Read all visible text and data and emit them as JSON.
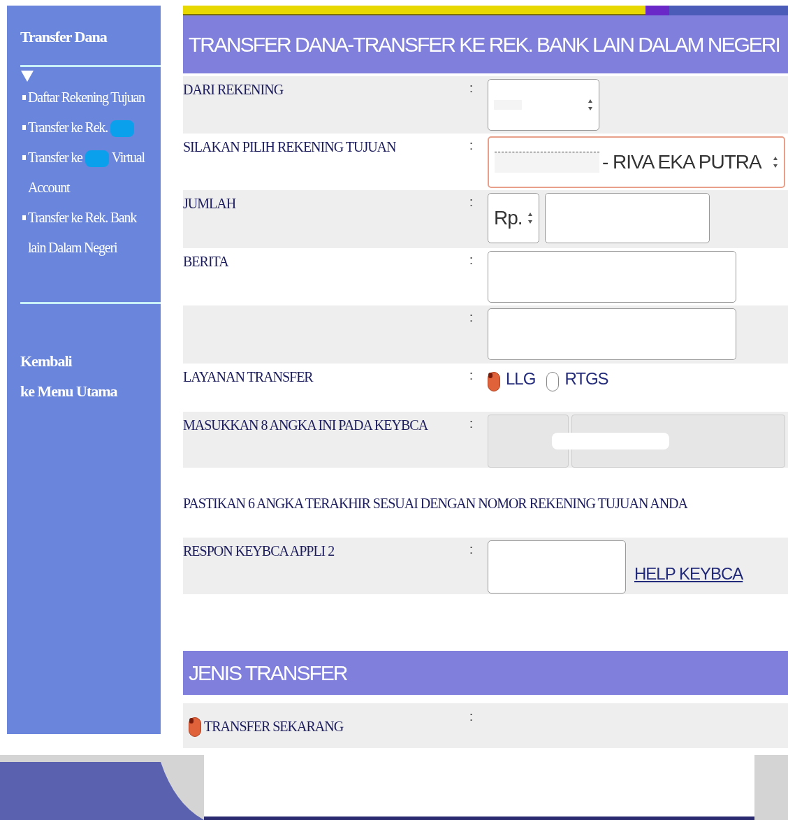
{
  "sidebar": {
    "title": "Transfer Dana",
    "expanded": true,
    "items": [
      {
        "parts": [
          {
            "kind": "text",
            "text": "Daftar Rekening Tujuan"
          }
        ]
      },
      {
        "parts": [
          {
            "kind": "text",
            "text": "Transfer ke Rek."
          },
          {
            "kind": "redacted"
          }
        ]
      },
      {
        "parts": [
          {
            "kind": "text",
            "text": "Transfer ke"
          },
          {
            "kind": "redacted"
          },
          {
            "kind": "text",
            "text": "Virtual Account"
          }
        ]
      },
      {
        "parts": [
          {
            "kind": "text",
            "text": "Transfer ke Rek. Bank lain Dalam Negeri"
          }
        ]
      }
    ],
    "back_link": [
      "Kembali",
      "ke Menu Utama"
    ]
  },
  "header": {
    "title": "TRANSFER DANA-TRANSFER KE REK. BANK LAIN DALAM NEGERI"
  },
  "rows": [
    {
      "kind": "select",
      "label": "DARI REKENING",
      "colon": ":"
    },
    {
      "kind": "select_wide",
      "label": "SILAKAN PILIH REKENING TUJUAN",
      "colon": ":",
      "value": "- RIVA EKA PUTRA"
    },
    {
      "kind": "amount",
      "label": "JUMLAH",
      "colon": ":",
      "currency": "Rp."
    },
    {
      "kind": "text",
      "label": "BERITA",
      "colon": ":"
    },
    {
      "kind": "text",
      "colon": ":"
    },
    {
      "kind": "radio",
      "label": "LAYANAN TRANSFER",
      "colon": ":",
      "options": [
        {
          "label": "LLG",
          "selected": true
        },
        {
          "label": "RTGS",
          "selected": false
        }
      ]
    },
    {
      "kind": "code",
      "label": "MASUKKAN 8 ANGKA INI PADA KEYBCA",
      "colon": ":"
    },
    {
      "kind": "note",
      "label": "PASTIKAN 6 ANGKA TERAKHIR SESUAI DENGAN NOMOR REKENING TUJUAN ANDA"
    },
    {
      "kind": "response",
      "label": "RESPON KEYBCA APPLI 2",
      "colon": ":",
      "link": "HELP KEYBCA"
    }
  ],
  "section": {
    "title": "JENIS TRANSFER",
    "option": {
      "label": "TRANSFER SEKARANG",
      "selected": true
    },
    "colon": ":"
  }
}
